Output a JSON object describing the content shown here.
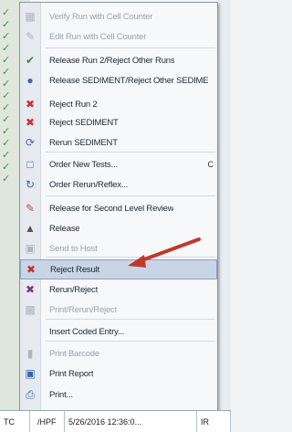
{
  "menu": {
    "items": [
      {
        "label": "Verify Run with Cell Counter",
        "icon": "verify-icon",
        "disabled": true
      },
      {
        "label": "Edit Run with Cell Counter",
        "icon": "edit-icon",
        "disabled": true
      },
      {
        "label": "Release Run 2/Reject Other Runs",
        "icon": "release-run-icon",
        "disabled": false
      },
      {
        "label": "Release SEDIMENT/Reject Other SEDIME",
        "icon": "release-sediment-icon",
        "disabled": false
      },
      {
        "label": "Reject Run 2",
        "icon": "reject-run-icon",
        "disabled": false
      },
      {
        "label": "Reject SEDIMENT",
        "icon": "reject-sediment-icon",
        "disabled": false
      },
      {
        "label": "Rerun SEDIMENT",
        "icon": "rerun-sediment-icon",
        "disabled": false
      },
      {
        "label": "Order New Tests...",
        "icon": "order-new-icon",
        "disabled": false
      },
      {
        "label": "Order Rerun/Reflex...",
        "icon": "order-rerun-icon",
        "disabled": false
      },
      {
        "label": "Release for Second Level Review",
        "icon": "second-review-icon",
        "disabled": false
      },
      {
        "label": "Release",
        "icon": "release-icon",
        "disabled": false
      },
      {
        "label": "Send to Host",
        "icon": "send-host-icon",
        "disabled": true
      },
      {
        "label": "Reject Result",
        "icon": "reject-result-icon",
        "disabled": false,
        "highlighted": true
      },
      {
        "label": "Rerun/Reject",
        "icon": "rerun-reject-icon",
        "disabled": false
      },
      {
        "label": "Print/Rerun/Reject",
        "icon": "print-rerun-icon",
        "disabled": true
      },
      {
        "label": "Insert Coded Entry...",
        "icon": "",
        "disabled": false
      },
      {
        "label": "Print Barcode",
        "icon": "barcode-icon",
        "disabled": true
      },
      {
        "label": "Print Report",
        "icon": "print-report-icon",
        "disabled": false
      },
      {
        "label": "Print...",
        "icon": "print-icon",
        "disabled": false
      }
    ],
    "trailing_char": "C"
  },
  "bottom_row": {
    "col1": "TC",
    "col2": "/HPF",
    "col3": "5/26/2016 12:36:0...",
    "col4": "IR"
  },
  "colors": {
    "highlight": "#c9d4e6",
    "arrow": "#c0392b"
  }
}
